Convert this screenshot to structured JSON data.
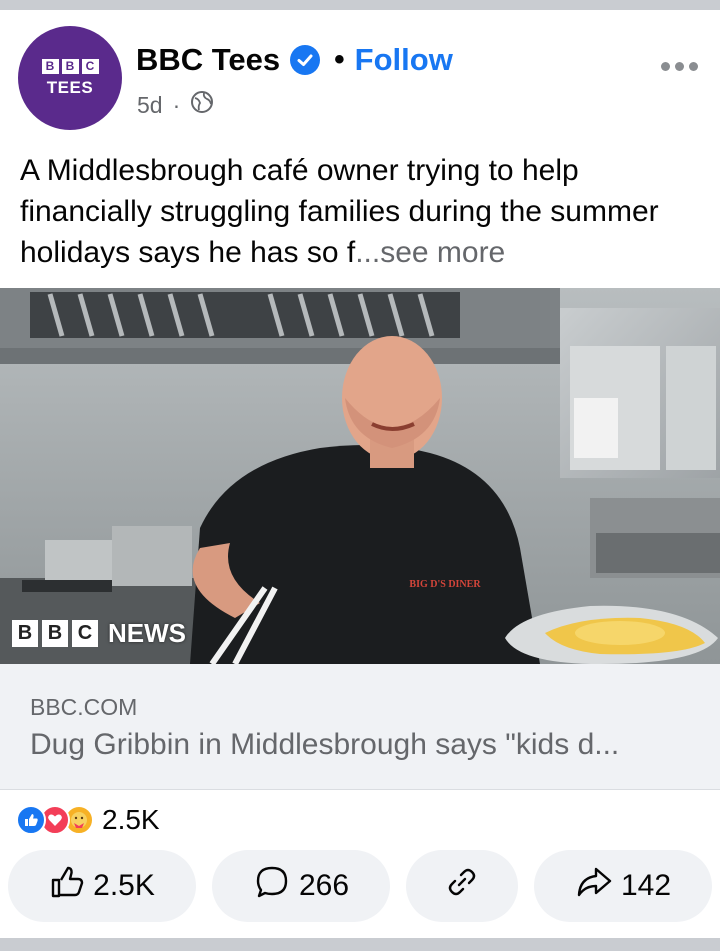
{
  "post": {
    "author": "BBC Tees",
    "avatar": {
      "top": "BBC",
      "sub": "TEES",
      "color": "#5a2a8c"
    },
    "follow_label": "Follow",
    "separator": "•",
    "time": "5d",
    "meta_dot": "·",
    "text": "A Middlesbrough café owner trying to help financially struggling families during the summer holidays says he has so f",
    "see_more": "...see more"
  },
  "photo": {
    "watermark": {
      "letters": [
        "B",
        "B",
        "C"
      ],
      "label": "NEWS"
    },
    "shirt_print": "BIG D'S DINER"
  },
  "link_preview": {
    "domain": "BBC.COM",
    "title": "Dug Gribbin in Middlesbrough says \"kids d..."
  },
  "reactions": {
    "types": [
      "like",
      "love",
      "care"
    ],
    "count": "2.5K"
  },
  "actions": {
    "like_count": "2.5K",
    "comment_count": "266",
    "share_count": "142"
  },
  "colors": {
    "accent": "#1877f2",
    "secondary_text": "#65676b",
    "pill_bg": "#f0f2f5"
  }
}
